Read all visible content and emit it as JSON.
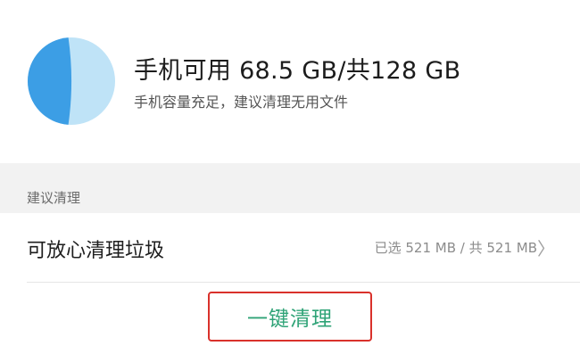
{
  "storage": {
    "available_gb": 68.5,
    "total_gb": 128,
    "used_fraction": 0.465,
    "chart_colors": {
      "available": "#bfe3f7",
      "used": "#3c9ee5"
    }
  },
  "header": {
    "title": "手机可用 68.5 GB/共128 GB",
    "subtitle": "手机容量充足，建议清理无用文件"
  },
  "section": {
    "label": "建议清理"
  },
  "list": {
    "items": [
      {
        "label": "可放心清理垃圾",
        "value": "已选 521 MB / 共 521 MB",
        "chevron": "〉"
      }
    ]
  },
  "actions": {
    "one_click_clean": "一键清理"
  },
  "colors": {
    "accent_green": "#2fa377",
    "highlight_red": "#d9312b",
    "section_bg": "#f2f2f2"
  }
}
